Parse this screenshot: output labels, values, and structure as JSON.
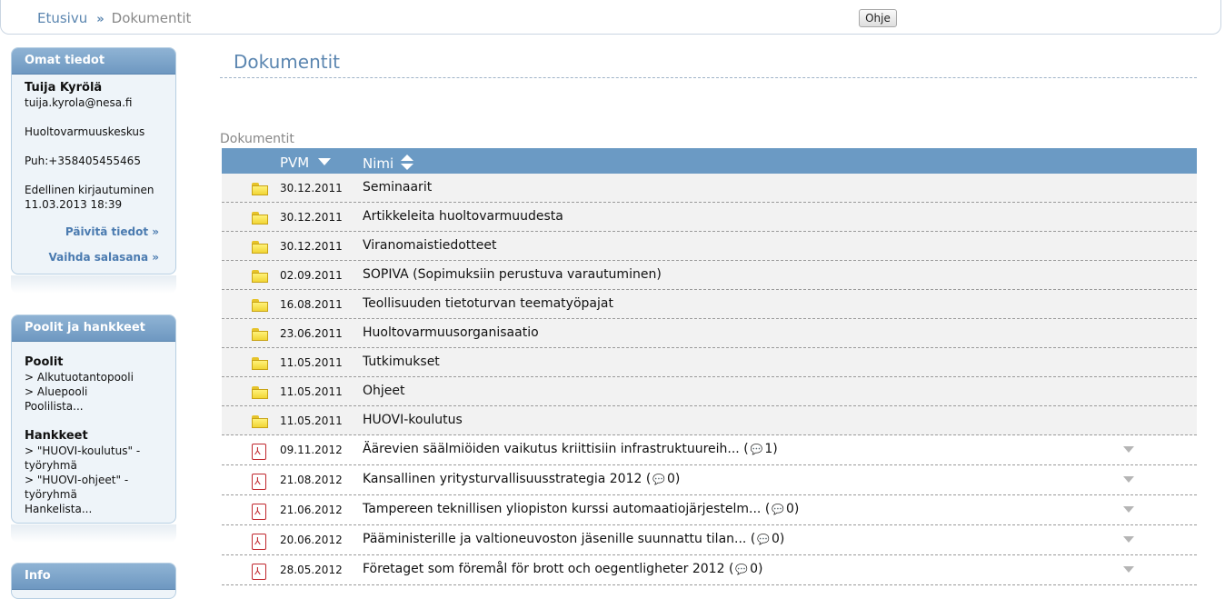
{
  "breadcrumb": {
    "home": "Etusivu",
    "separator": "»",
    "current": "Dokumentit"
  },
  "help_button": "Ohje",
  "profile_box": {
    "title": "Omat tiedot",
    "name": "Tuija Kyrölä",
    "email": "tuija.kyrola@nesa.fi",
    "organization": "Huoltovarmuuskeskus",
    "phone": "Puh:+358405455465",
    "last_login_label": "Edellinen kirjautuminen",
    "last_login": "11.03.2013 18:39",
    "update_link": "Päivitä tiedot »",
    "password_link": "Vaihda salasana »"
  },
  "pools_box": {
    "title": "Poolit ja hankkeet",
    "pools_heading": "Poolit",
    "pools": [
      "> Alkutuotantopooli",
      "> Aluepooli"
    ],
    "pool_list_link": "Poolilista...",
    "projects_heading": "Hankkeet",
    "projects": [
      "> \"HUOVI-koulutus\" - työryhmä",
      "> \"HUOVI-ohjeet\" - työryhmä"
    ],
    "project_list_link": "Hankelista..."
  },
  "info_box": {
    "title": "Info"
  },
  "main": {
    "title": "Dokumentit",
    "section_label": "Dokumentit",
    "columns": {
      "date": "PVM",
      "name": "Nimi"
    },
    "rows": [
      {
        "type": "folder",
        "date": "30.12.2011",
        "name": "Seminaarit"
      },
      {
        "type": "folder",
        "date": "30.12.2011",
        "name": "Artikkeleita huoltovarmuudesta"
      },
      {
        "type": "folder",
        "date": "30.12.2011",
        "name": "Viranomaistiedotteet"
      },
      {
        "type": "folder",
        "date": "02.09.2011",
        "name": "SOPIVA (Sopimuksiin perustuva varautuminen)"
      },
      {
        "type": "folder",
        "date": "16.08.2011",
        "name": "Teollisuuden tietoturvan teematyöpajat"
      },
      {
        "type": "folder",
        "date": "23.06.2011",
        "name": "Huoltovarmuusorganisaatio"
      },
      {
        "type": "folder",
        "date": "11.05.2011",
        "name": "Tutkimukset"
      },
      {
        "type": "folder",
        "date": "11.05.2011",
        "name": "Ohjeet"
      },
      {
        "type": "folder",
        "date": "11.05.2011",
        "name": "HUOVI-koulutus"
      },
      {
        "type": "pdf",
        "date": "09.11.2012",
        "name": "Äärevien säälmiöiden vaikutus kriittisiin infrastruktuureih... (",
        "comments": "1)"
      },
      {
        "type": "pdf",
        "date": "21.08.2012",
        "name": "Kansallinen yritysturvallisuusstrategia 2012 (",
        "comments": "0)"
      },
      {
        "type": "pdf",
        "date": "21.06.2012",
        "name": "Tampereen teknillisen yliopiston kurssi automaatiojärjestelm... (",
        "comments": "0)"
      },
      {
        "type": "pdf",
        "date": "20.06.2012",
        "name": "Pääministerille ja valtioneuvoston jäsenille suunnattu tilan... (",
        "comments": "0)"
      },
      {
        "type": "pdf",
        "date": "28.05.2012",
        "name": "Företaget som föremål för brott och oegentligheter 2012 (",
        "comments": "0)"
      }
    ]
  }
}
